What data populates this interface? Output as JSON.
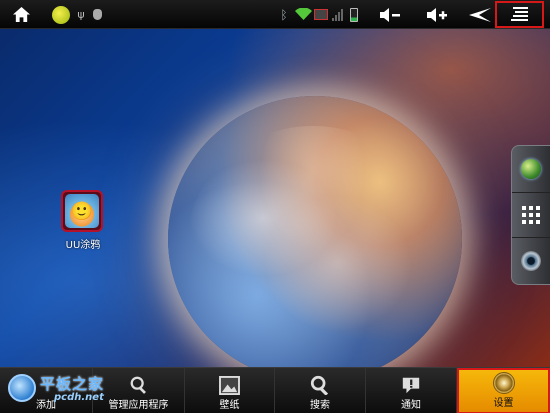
{
  "status_bar": {
    "icons": [
      "home-icon",
      "uu-notification-icon",
      "usb-icon",
      "debug-icon",
      "bluetooth-icon",
      "wifi-icon",
      "sim-icon",
      "signal-icon",
      "battery-icon",
      "volume-down-icon",
      "volume-up-icon",
      "back-icon",
      "menu-icon"
    ]
  },
  "desktop": {
    "apps": [
      {
        "label": "UU涂鸦",
        "icon": "uu-tuya-icon"
      }
    ]
  },
  "dock": {
    "items": [
      "browser-icon",
      "app-drawer-icon",
      "camera-icon"
    ]
  },
  "bottom_menu": {
    "items": [
      {
        "label": "添加",
        "icon": "add-icon"
      },
      {
        "label": "管理应用程序",
        "icon": "manage-apps-icon"
      },
      {
        "label": "壁纸",
        "icon": "wallpaper-icon"
      },
      {
        "label": "搜索",
        "icon": "search-icon"
      },
      {
        "label": "通知",
        "icon": "notification-icon"
      },
      {
        "label": "设置",
        "icon": "settings-icon"
      }
    ]
  },
  "watermark": {
    "cn": "平板之家",
    "url": "pcdh.net"
  },
  "colors": {
    "highlight_border": "#d61818",
    "selected_item": "#f0a300"
  }
}
